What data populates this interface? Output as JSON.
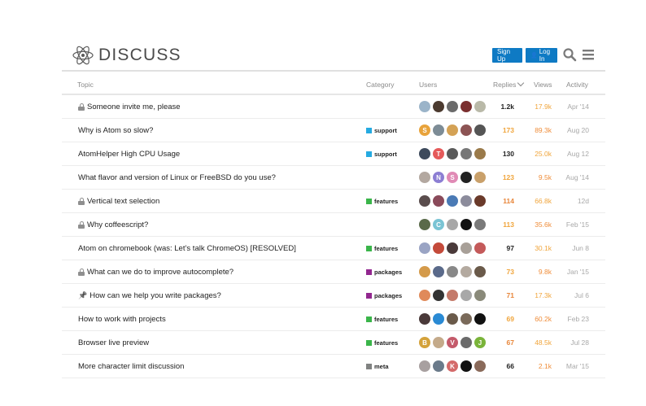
{
  "header": {
    "logo_text": "DISCUSS",
    "signup_label": "Sign Up",
    "login_label": "Log In",
    "accent": "#0e7ac4"
  },
  "table": {
    "columns": [
      "Topic",
      "Category",
      "Users",
      "Replies",
      "Views",
      "Activity"
    ]
  },
  "topics": [
    {
      "title": "Someone invite me, please",
      "icon": "lock",
      "category": "",
      "replies": "1.2k",
      "views": "17.9k",
      "activity": "Apr '14",
      "avatars": [
        {
          "letter": "",
          "color": "#9bb4c9"
        },
        {
          "letter": "",
          "color": "#4b3a2f"
        },
        {
          "letter": "",
          "color": "#6b6b6b"
        },
        {
          "letter": "",
          "color": "#7a2f2f"
        },
        {
          "letter": "",
          "color": "#b9b9a8"
        }
      ]
    },
    {
      "title": "Why is Atom so slow?",
      "icon": "",
      "category": "support",
      "replies": "173",
      "views": "89.3k",
      "activity": "Aug 20",
      "avatars": [
        {
          "letter": "S",
          "color": "#e8a33b"
        },
        {
          "letter": "",
          "color": "#7d8c96"
        },
        {
          "letter": "",
          "color": "#d4a255"
        },
        {
          "letter": "",
          "color": "#8c5454"
        },
        {
          "letter": "",
          "color": "#555555"
        }
      ]
    },
    {
      "title": "AtomHelper High CPU Usage",
      "icon": "",
      "category": "support",
      "replies": "130",
      "views": "25.0k",
      "activity": "Aug 12",
      "avatars": [
        {
          "letter": "",
          "color": "#3d4a5c"
        },
        {
          "letter": "T",
          "color": "#e55a5a"
        },
        {
          "letter": "",
          "color": "#5a5a5a"
        },
        {
          "letter": "",
          "color": "#777777"
        },
        {
          "letter": "",
          "color": "#9a7a4a"
        }
      ]
    },
    {
      "title": "What flavor and version of Linux or FreeBSD do you use?",
      "icon": "",
      "category": "",
      "replies": "123",
      "views": "9.5k",
      "activity": "Aug '14",
      "avatars": [
        {
          "letter": "",
          "color": "#b3a8a0"
        },
        {
          "letter": "N",
          "color": "#8c7ed3"
        },
        {
          "letter": "S",
          "color": "#e08ab5"
        },
        {
          "letter": "",
          "color": "#222222"
        },
        {
          "letter": "",
          "color": "#c9a06a"
        }
      ]
    },
    {
      "title": "Vertical text selection",
      "icon": "lock",
      "category": "features",
      "replies": "114",
      "views": "66.8k",
      "activity": "12d",
      "avatars": [
        {
          "letter": "",
          "color": "#5a4d4d"
        },
        {
          "letter": "",
          "color": "#8a4a5a"
        },
        {
          "letter": "",
          "color": "#4a7ab5"
        },
        {
          "letter": "",
          "color": "#8c8c9c"
        },
        {
          "letter": "",
          "color": "#6a3a2a"
        }
      ]
    },
    {
      "title": "Why coffeescript?",
      "icon": "lock",
      "category": "",
      "replies": "113",
      "views": "35.6k",
      "activity": "Feb '15",
      "avatars": [
        {
          "letter": "",
          "color": "#5a6a4a"
        },
        {
          "letter": "C",
          "color": "#7ac4d4"
        },
        {
          "letter": "",
          "color": "#a8a8a8"
        },
        {
          "letter": "",
          "color": "#111111"
        },
        {
          "letter": "",
          "color": "#7a7a7a"
        }
      ]
    },
    {
      "title": "Atom on chromebook (was: Let’s talk ChromeOS) [RESOLVED]",
      "icon": "",
      "category": "features",
      "replies": "97",
      "views": "30.1k",
      "activity": "Jun 8",
      "avatars": [
        {
          "letter": "",
          "color": "#9aa4c4"
        },
        {
          "letter": "",
          "color": "#c44a3a"
        },
        {
          "letter": "",
          "color": "#4a3a3a"
        },
        {
          "letter": "",
          "color": "#a8a098"
        },
        {
          "letter": "",
          "color": "#c45a5a"
        }
      ]
    },
    {
      "title": "What can we do to improve autocomplete?",
      "icon": "lock",
      "category": "packages",
      "replies": "73",
      "views": "9.8k",
      "activity": "Jan '15",
      "avatars": [
        {
          "letter": "",
          "color": "#d49a4a"
        },
        {
          "letter": "",
          "color": "#5a6a8a"
        },
        {
          "letter": "",
          "color": "#888888"
        },
        {
          "letter": "",
          "color": "#b4aaa0"
        },
        {
          "letter": "",
          "color": "#6a5a4a"
        }
      ]
    },
    {
      "title": "How can we help you write packages?",
      "icon": "pin",
      "category": "packages",
      "replies": "71",
      "views": "17.3k",
      "activity": "Jul 6",
      "avatars": [
        {
          "letter": "",
          "color": "#e08a5a"
        },
        {
          "letter": "",
          "color": "#333333"
        },
        {
          "letter": "",
          "color": "#c47a6a"
        },
        {
          "letter": "",
          "color": "#a8a8a8"
        },
        {
          "letter": "",
          "color": "#8a8a7a"
        }
      ]
    },
    {
      "title": "How to work with projects",
      "icon": "",
      "category": "features",
      "replies": "69",
      "views": "60.2k",
      "activity": "Feb 23",
      "avatars": [
        {
          "letter": "",
          "color": "#4a3a3a"
        },
        {
          "letter": "",
          "color": "#2a8ad4"
        },
        {
          "letter": "",
          "color": "#6a5a4a"
        },
        {
          "letter": "",
          "color": "#7a6a5a"
        },
        {
          "letter": "",
          "color": "#111111"
        }
      ]
    },
    {
      "title": "Browser live preview",
      "icon": "",
      "category": "features",
      "replies": "67",
      "views": "48.5k",
      "activity": "Jul 28",
      "avatars": [
        {
          "letter": "B",
          "color": "#d4a23a"
        },
        {
          "letter": "",
          "color": "#c4aa8a"
        },
        {
          "letter": "V",
          "color": "#c45a6a"
        },
        {
          "letter": "",
          "color": "#6a6a6a"
        },
        {
          "letter": "J",
          "color": "#7ab43a"
        }
      ]
    },
    {
      "title": "More character limit discussion",
      "icon": "",
      "category": "meta",
      "replies": "66",
      "views": "2.1k",
      "activity": "Mar '15",
      "avatars": [
        {
          "letter": "",
          "color": "#a8a0a0"
        },
        {
          "letter": "",
          "color": "#6a7a8a"
        },
        {
          "letter": "K",
          "color": "#d46a6a"
        },
        {
          "letter": "",
          "color": "#111111"
        },
        {
          "letter": "",
          "color": "#8a6a5a"
        }
      ]
    }
  ],
  "category_colors": {
    "support": "#25aae1",
    "features": "#3ab54a",
    "packages": "#92278f",
    "meta": "#808281"
  },
  "replies_colors": [
    "#222222",
    "#f0a53c",
    "#e8863a"
  ],
  "views_colors": [
    "#f0a53c",
    "#ef8d3a"
  ],
  "activity_color": "#a8a8a8"
}
